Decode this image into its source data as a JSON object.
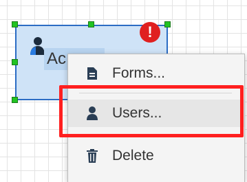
{
  "canvas": {
    "node": {
      "label": "Ac",
      "alert_glyph": "!",
      "icon": "person-icon",
      "alert_icon": "alert-icon",
      "accent": "#2b6cc4",
      "handle_color": "#22c322",
      "alert_color": "#e02020"
    }
  },
  "context_menu": {
    "items": [
      {
        "label": "Forms...",
        "icon": "document-icon"
      },
      {
        "label": "Users...",
        "icon": "user-icon"
      },
      {
        "label": "Delete",
        "icon": "trash-icon"
      }
    ],
    "highlighted_index": 1,
    "highlight_color": "#ff1f1f"
  }
}
